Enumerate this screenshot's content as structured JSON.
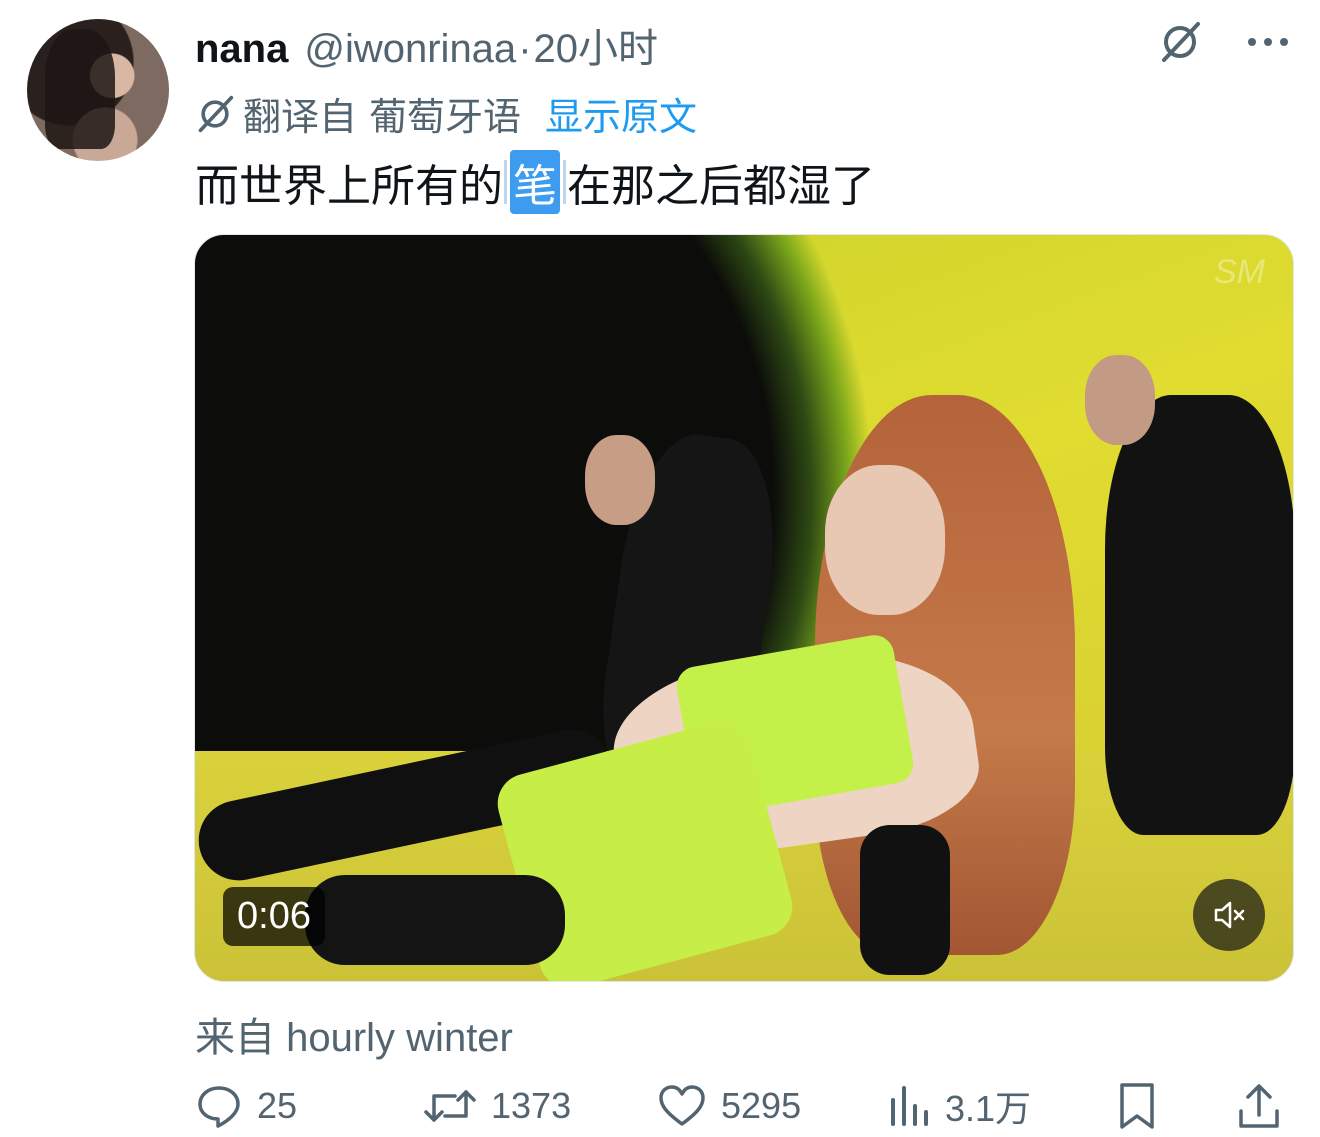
{
  "tweet": {
    "author_name": "nana",
    "handle": "@iwonrinaa",
    "separator": "·",
    "time": "20小时",
    "translation": {
      "label": "翻译自",
      "language": "葡萄牙语",
      "show_original": "显示原文"
    },
    "text_before": "而世界上所有的",
    "text_highlight": "笔",
    "text_after": "在那之后都湿了",
    "media": {
      "watermark": "SM",
      "duration": "0:06"
    },
    "source": "来自 hourly winter"
  },
  "actions": {
    "replies": "25",
    "retweets": "1373",
    "likes": "5295",
    "views": "3.1万"
  },
  "icons": {
    "grok": "slash-circle-icon",
    "more": "more-icon",
    "reply": "reply-icon",
    "retweet": "retweet-icon",
    "like": "heart-icon",
    "views": "views-icon",
    "bookmark": "bookmark-icon",
    "share": "share-icon",
    "mute": "mute-icon"
  }
}
